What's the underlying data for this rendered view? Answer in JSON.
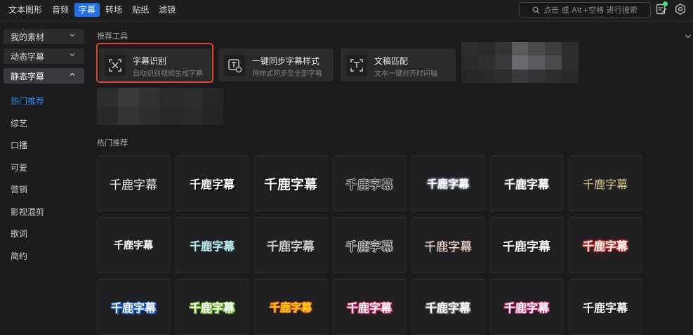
{
  "topbar": {
    "tabs": [
      "文本图形",
      "音频",
      "字幕",
      "转场",
      "贴纸",
      "滤镜"
    ],
    "active_tab": 2,
    "search_placeholder": "点击 或 Alt+空格 进行搜索"
  },
  "sidebar": {
    "categories": [
      {
        "label": "我的素材",
        "open": false
      },
      {
        "label": "动态字幕",
        "open": false
      },
      {
        "label": "静态字幕",
        "open": true
      }
    ],
    "items": [
      "热门推荐",
      "综艺",
      "口播",
      "可爱",
      "营销",
      "影视混剪",
      "歌词",
      "简约"
    ],
    "active_item": 0
  },
  "main": {
    "tools_title": "推荐工具",
    "tools": [
      {
        "title": "字幕识别",
        "desc": "自动识别视频生成字幕",
        "icon": "subtitle-recognize-icon"
      },
      {
        "title": "一键同步字幕样式",
        "desc": "将样式同步至全部字幕",
        "icon": "sync-style-icon"
      },
      {
        "title": "文稿匹配",
        "desc": "文本一键对齐时间轴",
        "icon": "text-match-icon"
      }
    ],
    "hot_title": "热门推荐",
    "preset_text": "千鹿字幕"
  },
  "colors": {
    "accent": "#1f6fe5",
    "active_text": "#2b8cf5",
    "highlight_border": "#e0432e"
  }
}
